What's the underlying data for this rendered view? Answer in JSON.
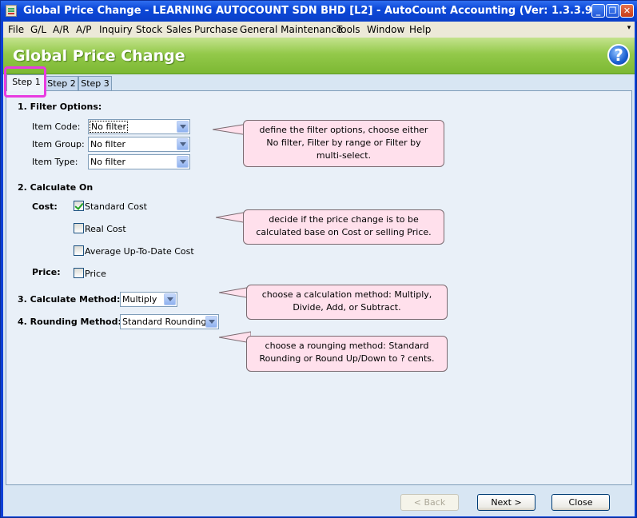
{
  "window": {
    "title": "Global Price Change - LEARNING AUTOCOUNT SDN BHD [L2] - AutoCount Accounting (Ver: 1.3.3.9)",
    "minimize": "_",
    "restore": "❐",
    "close": "✕"
  },
  "menu": {
    "items": [
      {
        "label": "File"
      },
      {
        "label": "G/L"
      },
      {
        "label": "A/R"
      },
      {
        "label": "A/P"
      },
      {
        "label": "Inquiry"
      },
      {
        "label": "Stock"
      },
      {
        "label": "Sales"
      },
      {
        "label": "Purchase"
      },
      {
        "label": "General Maintenance"
      },
      {
        "label": "Tools"
      },
      {
        "label": "Window"
      },
      {
        "label": "Help"
      }
    ],
    "overflow": "▾"
  },
  "header": {
    "title": "Global Price Change",
    "help": "?"
  },
  "tabs": [
    {
      "label": "Step 1",
      "active": true
    },
    {
      "label": "Step 2",
      "active": false
    },
    {
      "label": "Step 3",
      "active": false
    }
  ],
  "filter": {
    "heading": "1. Filter Options:",
    "item_code_label": "Item Code:",
    "item_code_value": "No filter",
    "item_group_label": "Item Group:",
    "item_group_value": "No filter",
    "item_type_label": "Item Type:",
    "item_type_value": "No filter"
  },
  "calculate_on": {
    "heading": "2. Calculate On",
    "cost_label": "Cost:",
    "standard_cost": {
      "label": "Standard Cost",
      "checked": true
    },
    "real_cost": {
      "label": "Real Cost",
      "checked": false
    },
    "average_cost": {
      "label": "Average Up-To-Date Cost",
      "checked": false
    },
    "price_label": "Price:",
    "price": {
      "label": "Price",
      "checked": false
    }
  },
  "method": {
    "calc_label": "3. Calculate Method:",
    "calc_value": "Multiply",
    "rounding_label": "4. Rounding Method:",
    "rounding_value": "Standard Rounding"
  },
  "callouts": {
    "filter": [
      "define the filter options, choose either",
      "No filter, Filter by range or Filter by",
      "multi-select."
    ],
    "calculate": [
      "decide if the price change is to be",
      "calculated base on Cost or selling Price."
    ],
    "method": [
      "choose a calculation method: Multiply,",
      "Divide, Add, or Subtract."
    ],
    "rounding": [
      "choose a rounging method: Standard",
      "Rounding or Round Up/Down to ? cents."
    ]
  },
  "footer": {
    "back": "< Back",
    "next": "Next >",
    "close": "Close"
  },
  "colors": {
    "header_green": "#7cb833",
    "highlight": "#e83be0",
    "callout_bg": "#ffe0ec",
    "titlebar": "#0c48d8"
  }
}
